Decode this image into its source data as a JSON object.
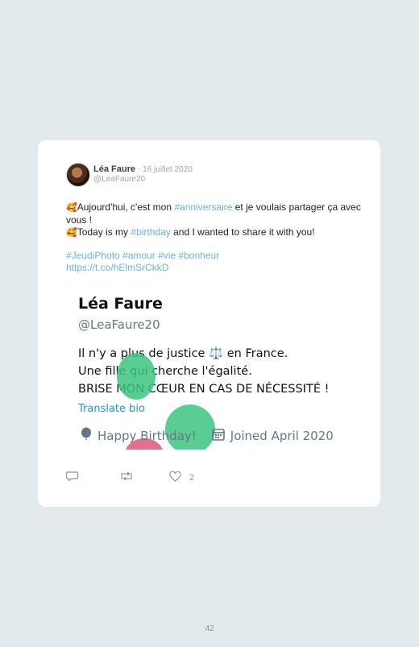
{
  "tweet": {
    "author_name": "Léa Faure",
    "date": "· 16 juillet 2020",
    "handle": "@LeaFaure20",
    "line1_emoji": "🥰",
    "line1_a": "Aujourd'hui, c'est mon ",
    "line1_tag": "#anniversaire",
    "line1_b": " et je voulais partager ça avec vous !",
    "line2_emoji": "🥰",
    "line2_a": "Today is my ",
    "line2_tag": "#birthday",
    "line2_b": " and I wanted to share it with you!",
    "hashtags": "#JeudiPhoto #amour #vie #bonheur",
    "link": "https://t.co/hElmSrCkkD",
    "like_count": "2"
  },
  "profile": {
    "name": "Léa Faure",
    "handle": "@LeaFaure20",
    "bio_line1_a": "Il n'y a plus de justice ",
    "bio_line1_emoji": "⚖️",
    "bio_line1_b": " en France.",
    "bio_line2": "Une fille qui cherche l'égalité.",
    "bio_line3": "BRISE MON CŒUR EN CAS DE NÉCESSITÉ !",
    "translate": "Translate bio",
    "birthday": "Happy Birthday!",
    "joined": "Joined April 2020"
  },
  "page": {
    "number": "42"
  },
  "colors": {
    "accent": "#6bb2dd",
    "balloon_green": "#3cc47f",
    "balloon_pink": "#e0567a"
  },
  "icons": [
    "reply-icon",
    "retweet-icon",
    "like-icon",
    "balloon-icon",
    "calendar-icon"
  ]
}
